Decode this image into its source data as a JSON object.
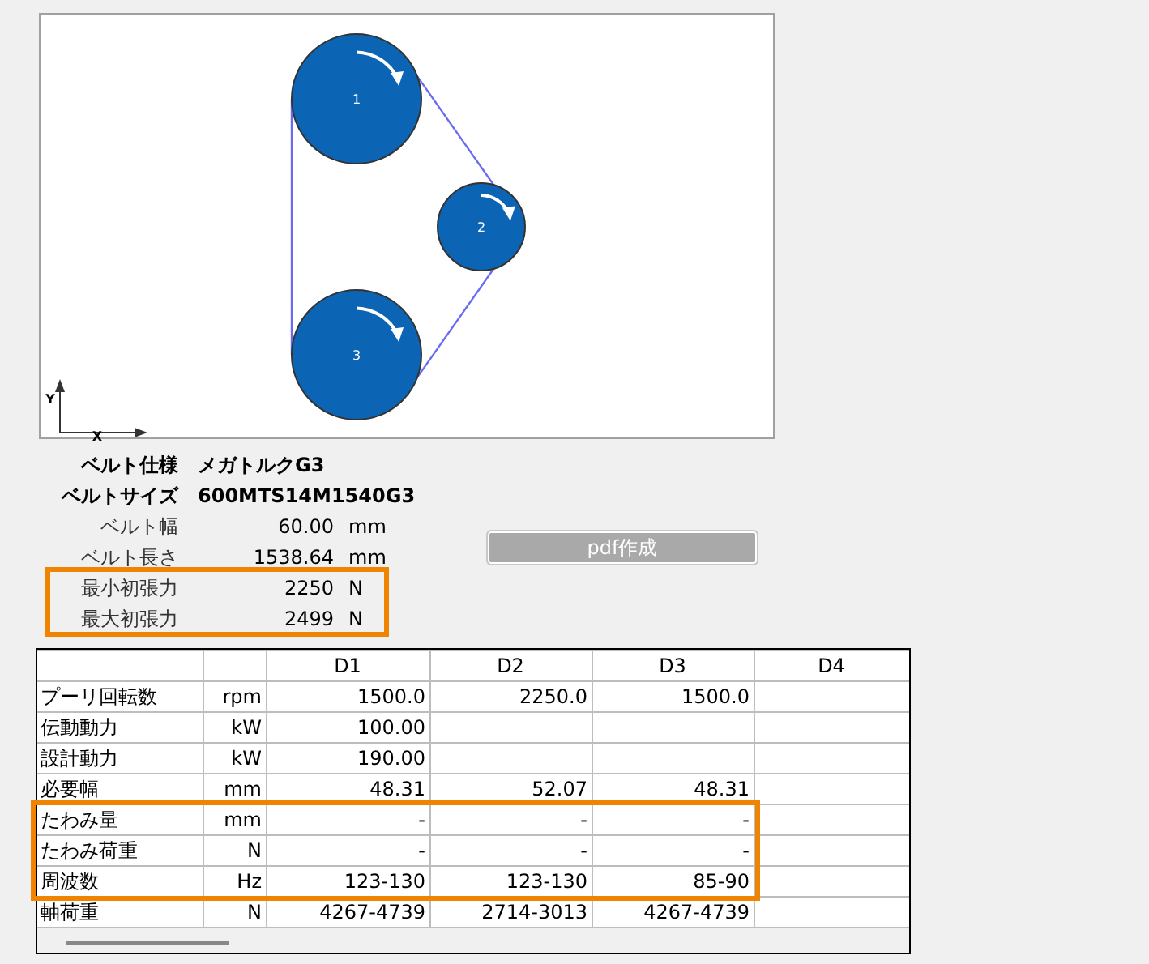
{
  "diagram": {
    "pulleys": [
      {
        "label": "1"
      },
      {
        "label": "2"
      },
      {
        "label": "3"
      }
    ],
    "axes": {
      "x": "X",
      "y": "Y"
    }
  },
  "specs": [
    {
      "kind": "spec",
      "label": "ベルト仕様",
      "value": "メガトルクG3",
      "highlighted": false
    },
    {
      "kind": "spec",
      "label": "ベルトサイズ",
      "value": "600MTS14M1540G3",
      "highlighted": false
    },
    {
      "kind": "measure",
      "label": "ベルト幅",
      "value": "60.00",
      "unit": "mm",
      "highlighted": false
    },
    {
      "kind": "measure",
      "label": "ベルト長さ",
      "value": "1538.64",
      "unit": "mm",
      "highlighted": false
    },
    {
      "kind": "measure",
      "label": "最小初張力",
      "value": "2250",
      "unit": "N",
      "highlighted": true
    },
    {
      "kind": "measure",
      "label": "最大初張力",
      "value": "2499",
      "unit": "N",
      "highlighted": true
    }
  ],
  "pdf_button": {
    "label": "pdf作成",
    "disabled": true
  },
  "table": {
    "columns": [
      "D1",
      "D2",
      "D3",
      "D4"
    ],
    "rows": [
      {
        "label": "プーリ回転数",
        "unit": "rpm",
        "values": [
          "1500.0",
          "2250.0",
          "1500.0"
        ],
        "highlighted": false
      },
      {
        "label": "伝動動力",
        "unit": "kW",
        "values": [
          "100.00"
        ],
        "highlighted": false
      },
      {
        "label": "設計動力",
        "unit": "kW",
        "values": [
          "190.00"
        ],
        "highlighted": false
      },
      {
        "label": "必要幅",
        "unit": "mm",
        "values": [
          "48.31",
          "52.07",
          "48.31"
        ],
        "highlighted": false
      },
      {
        "label": "たわみ量",
        "unit": "mm",
        "values": [
          "-",
          "-",
          "-"
        ],
        "highlighted": true
      },
      {
        "label": "たわみ荷重",
        "unit": "N",
        "values": [
          "-",
          "-",
          "-"
        ],
        "highlighted": true
      },
      {
        "label": "周波数",
        "unit": "Hz",
        "values": [
          "123-130",
          "123-130",
          "85-90"
        ],
        "highlighted": true
      },
      {
        "label": "軸荷重",
        "unit": "N",
        "values": [
          "4267-4739",
          "2714-3013",
          "4267-4739"
        ],
        "highlighted": false
      }
    ]
  }
}
